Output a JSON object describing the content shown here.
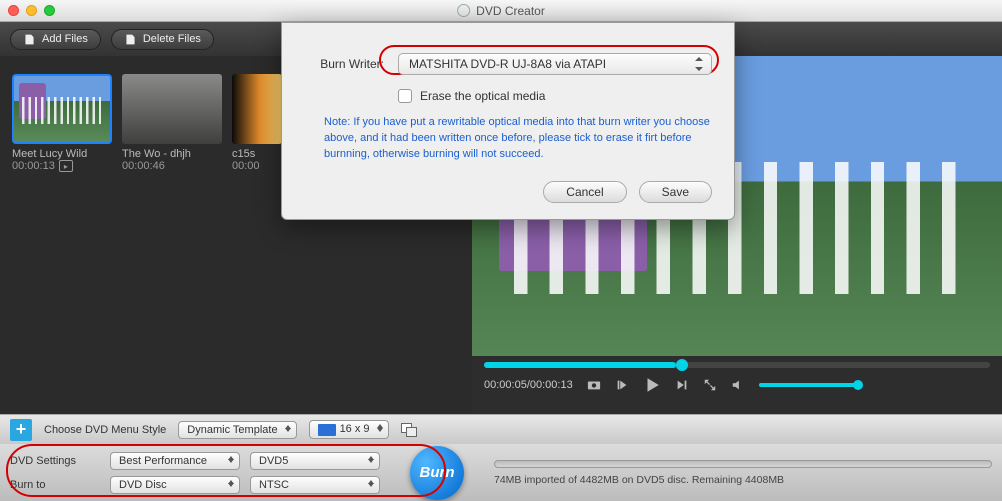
{
  "window": {
    "title": "DVD Creator"
  },
  "toolbar": {
    "add_files": "Add Files",
    "delete_files": "Delete Files"
  },
  "clips": [
    {
      "name": "Meet Lucy Wild",
      "time": "00:00:13",
      "selected": true,
      "editable": true
    },
    {
      "name": "The Wo - dhjh",
      "time": "00:00:46",
      "selected": false,
      "editable": false
    },
    {
      "name": "c15s",
      "time": "00:00",
      "selected": false,
      "editable": false
    }
  ],
  "preview": {
    "current": "00:00:05",
    "duration": "00:00:13",
    "progress_pct": 38
  },
  "menu_row": {
    "label": "Choose DVD Menu Style",
    "template": "Dynamic Template",
    "aspect": "16 x 9"
  },
  "settings": {
    "row1_label": "DVD Settings",
    "quality": "Best Performance",
    "disc_type": "DVD5",
    "row2_label": "Burn to",
    "burn_to": "DVD Disc",
    "standard": "NTSC"
  },
  "burn": {
    "label": "Burn"
  },
  "progress": {
    "text": "74MB imported of 4482MB on DVD5 disc. Remaining 4408MB"
  },
  "dialog": {
    "writer_label": "Burn Writer:",
    "writer_value": "MATSHITA DVD-R   UJ-8A8 via ATAPI",
    "erase_label": "Erase the optical media",
    "note": "Note: If you have put a rewritable optical media into that burn writer you choose above, and it had been written once before, please tick to erase it firt before burnning, otherwise burning will not succeed.",
    "cancel": "Cancel",
    "save": "Save"
  }
}
